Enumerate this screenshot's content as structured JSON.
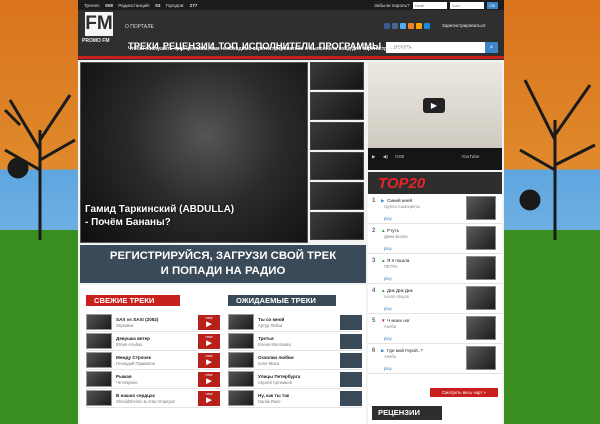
{
  "topbar": {
    "tracks_label": "Треков:",
    "tracks_value": "608",
    "stations_label": "Радиостанций:",
    "stations_value": "93",
    "cities_label": "Городов:",
    "cities_value": "277",
    "forgot": "Забыли пароль?",
    "email_placeholder": "email",
    "password_placeholder": "••••••",
    "ok": "ОК"
  },
  "header": {
    "logo_fm": "FM",
    "logo_promo": "PROMO FM",
    "portal": "О ПОРТАЛЕ",
    "register": "Зарегистрироваться",
    "nav": [
      "ТРЕКИ",
      "РЕЦЕНЗИИ",
      "ТОП",
      "ИСПОЛНИТЕЛИ",
      "ПРОГРАММЫ"
    ],
    "search_placeholder": "...искать",
    "notice": "Чтобы послушать трек целиком, вам необходимо зарегистрироваться и выполнить вход для зарегистрированных пользователей"
  },
  "hero": {
    "caption_line1": "Гамид Таркинский (ABDULLA)",
    "caption_line2": "- Почём Бананы?"
  },
  "video": {
    "time": "0:00",
    "brand": "YouTube"
  },
  "banner": {
    "line1": "РЕГИСТРИРУЙСЯ, ЗАГРУЗИ СВОЙ ТРЕК",
    "line2": "И ПОПАДИ НА РАДИО"
  },
  "fresh": {
    "title": "СВЕЖИЕ ТРЕКИ",
    "items": [
      {
        "title": "SAX vs SAXI (2052)",
        "artist": "Звуковик",
        "badge": "new"
      },
      {
        "title": "Девушка ветер",
        "artist": "Юлия Альбах",
        "badge": "new"
      },
      {
        "title": "Между Строчек",
        "artist": "Геннадий Правилов",
        "badge": "new"
      },
      {
        "title": "Рыжая",
        "artist": "Чё Морале",
        "badge": "new"
      },
      {
        "title": "В наших сердцах",
        "artist": "Shnaidzhenko & Artur Ampiryan",
        "badge": "new"
      }
    ]
  },
  "awaited": {
    "title": "ОЖИДАЕМЫЕ ТРЕКИ",
    "items": [
      {
        "title": "Ты со мной",
        "artist": "Артур Лабза"
      },
      {
        "title": "Третья",
        "artist": "Елена Молокова"
      },
      {
        "title": "Осколки любви",
        "artist": "none-Maxa"
      },
      {
        "title": "Улицы Петербурга",
        "artist": "Сергей Артемьев"
      },
      {
        "title": "Ну, как ты так",
        "artist": "Danila Rasc"
      }
    ]
  },
  "top20": {
    "title": "TOP20",
    "play": "play",
    "items": [
      {
        "n": "1",
        "title": "Синий иней",
        "artist": "группа Самоцветы"
      },
      {
        "n": "2",
        "title": "Ртуть",
        "artist": "Дима Билан"
      },
      {
        "n": "3",
        "title": "Я я пошла",
        "artist": "ПЕТРА"
      },
      {
        "n": "4",
        "title": "Дик Дик Дик",
        "artist": "Levon Alayan"
      },
      {
        "n": "5",
        "title": "Ч моих ног",
        "artist": "Анеба"
      },
      {
        "n": "6",
        "title": "Где мой Герой..?",
        "artist": "Анеба"
      }
    ],
    "see_all": "Смотреть весь чарт »"
  },
  "reviews": {
    "title": "РЕЦЕНЗИИ"
  },
  "colors": {
    "red": "#c8211d",
    "dark": "#2f2f2f",
    "blue": "#3b86c6",
    "top20": "#e8242a"
  }
}
